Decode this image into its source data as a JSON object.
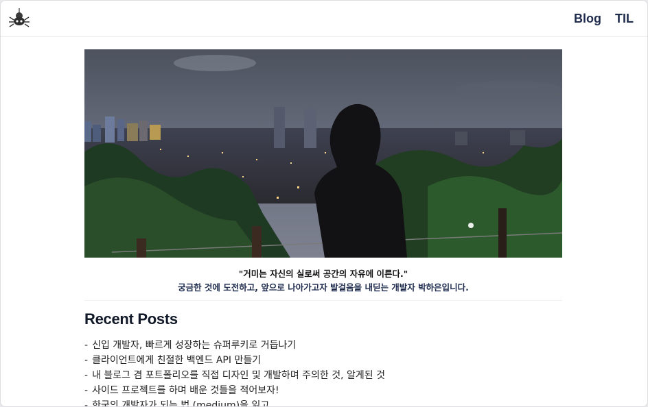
{
  "nav": {
    "logo_icon": "spider-icon",
    "links": [
      "Blog",
      "TIL"
    ]
  },
  "hero": {
    "alt": "night city view photo"
  },
  "intro": {
    "line1": "\"거미는 자신의 실로써 공간의 자유에 이른다.\"",
    "line2": "궁금한 것에 도전하고, 앞으로 나아가고자 발걸음을 내딛는 개발자 박하은입니다."
  },
  "recent": {
    "title": "Recent Posts",
    "posts": [
      "신입 개발자, 빠르게 성장하는 슈퍼루키로 거듭나기",
      "클라이언트에게 친절한 백엔드 API 만들기",
      "내 블로그 겸 포트폴리오를 직접 디자인 및 개발하며 주의한 것, 알게된 것",
      "사이드 프로젝트를 하며 배운 것들을 적어보자!",
      "한국의 개발자가 되는 법 (medium)을 읽고"
    ]
  }
}
